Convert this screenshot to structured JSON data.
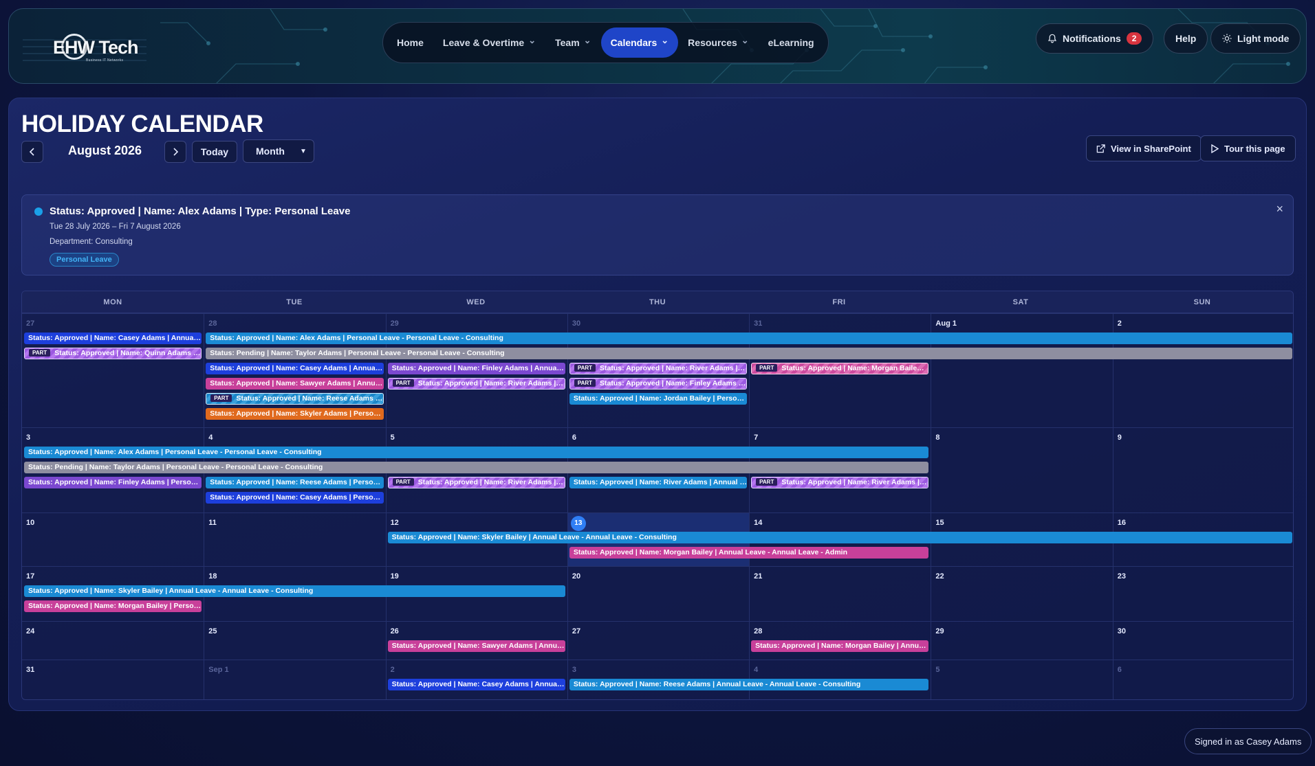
{
  "header": {
    "logo_text": "EHW Tech",
    "logo_sub": "Business IT Networks",
    "nav": [
      {
        "label": "Home",
        "dropdown": false,
        "active": false
      },
      {
        "label": "Leave & Overtime",
        "dropdown": true,
        "active": false
      },
      {
        "label": "Team",
        "dropdown": true,
        "active": false
      },
      {
        "label": "Calendars",
        "dropdown": true,
        "active": true
      },
      {
        "label": "Resources",
        "dropdown": true,
        "active": false
      },
      {
        "label": "eLearning",
        "dropdown": false,
        "active": false
      }
    ],
    "notifications_label": "Notifications",
    "notifications_count": "2",
    "help_label": "Help",
    "theme_label": "Light mode"
  },
  "page": {
    "title": "HOLIDAY CALENDAR",
    "month_label": "August 2026",
    "today_label": "Today",
    "view_select": "Month",
    "sharepoint_label": "View in SharePoint",
    "tour_label": "Tour this page"
  },
  "detail": {
    "title": "Status: Approved | Name: Alex Adams | Type: Personal Leave",
    "dates": "Tue 28 July 2026 – Fri 7 August 2026",
    "department": "Department: Consulting",
    "tag": "Personal Leave",
    "close": "×"
  },
  "calendar": {
    "weekdays": [
      "MON",
      "TUE",
      "WED",
      "THU",
      "FRI",
      "SAT",
      "SUN"
    ],
    "weeks": [
      {
        "days": [
          "27",
          "28",
          "29",
          "30",
          "31",
          "Aug 1",
          "2"
        ],
        "other": [
          true,
          true,
          true,
          true,
          true,
          false,
          false
        ]
      },
      {
        "days": [
          "3",
          "4",
          "5",
          "6",
          "7",
          "8",
          "9"
        ],
        "other": [
          false,
          false,
          false,
          false,
          false,
          false,
          false
        ]
      },
      {
        "days": [
          "10",
          "11",
          "12",
          "13",
          "14",
          "15",
          "16"
        ],
        "other": [
          false,
          false,
          false,
          false,
          false,
          false,
          false
        ]
      },
      {
        "days": [
          "17",
          "18",
          "19",
          "20",
          "21",
          "22",
          "23"
        ],
        "other": [
          false,
          false,
          false,
          false,
          false,
          false,
          false
        ]
      },
      {
        "days": [
          "24",
          "25",
          "26",
          "27",
          "28",
          "29",
          "30"
        ],
        "other": [
          false,
          false,
          false,
          false,
          false,
          false,
          false
        ]
      },
      {
        "days": [
          "31",
          "Sep 1",
          "2",
          "3",
          "4",
          "5",
          "6"
        ],
        "other": [
          false,
          true,
          true,
          true,
          true,
          true,
          true
        ]
      }
    ],
    "today": {
      "week": 2,
      "day": 3
    },
    "part_label": "PART",
    "events": [
      {
        "week": 0,
        "row": 0,
        "start": 0,
        "span": 1,
        "color": "royal",
        "part": false,
        "text": "Status: Approved | Name: Casey Adams | Annual Leave - Annual Leave - Consulting"
      },
      {
        "week": 0,
        "row": 0,
        "start": 1,
        "span": 6,
        "color": "blue",
        "part": false,
        "text": "Status: Approved | Name: Alex Adams | Personal Leave - Personal Leave - Consulting"
      },
      {
        "week": 0,
        "row": 1,
        "start": 0,
        "span": 1,
        "color": "purple",
        "part": true,
        "text": "Status: Approved | Name: Quinn Adams | Personal Leave"
      },
      {
        "week": 0,
        "row": 1,
        "start": 1,
        "span": 6,
        "color": "gray",
        "part": false,
        "text": "Status: Pending | Name: Taylor Adams | Personal Leave - Personal Leave - Consulting"
      },
      {
        "week": 0,
        "row": 2,
        "start": 1,
        "span": 1,
        "color": "royal",
        "part": false,
        "text": "Status: Approved | Name: Casey Adams | Annual Leave - Annual Leave - Consulting"
      },
      {
        "week": 0,
        "row": 2,
        "start": 2,
        "span": 1,
        "color": "purple",
        "part": false,
        "text": "Status: Approved | Name: Finley Adams | Annual Leave - Annual Leave - Consulting"
      },
      {
        "week": 0,
        "row": 2,
        "start": 3,
        "span": 1,
        "color": "purple",
        "part": true,
        "text": "Status: Approved | Name: River Adams | Personal Leave"
      },
      {
        "week": 0,
        "row": 2,
        "start": 4,
        "span": 1,
        "color": "pinkstripe",
        "part": true,
        "text": "Status: Approved | Name: Morgan Bailey | Annual Leave"
      },
      {
        "week": 0,
        "row": 3,
        "start": 1,
        "span": 1,
        "color": "pink",
        "part": false,
        "text": "Status: Approved | Name: Sawyer Adams | Annual Leave - Annual Leave - Consulting"
      },
      {
        "week": 0,
        "row": 3,
        "start": 2,
        "span": 1,
        "color": "purple",
        "part": true,
        "text": "Status: Approved | Name: River Adams | Annual Leave"
      },
      {
        "week": 0,
        "row": 3,
        "start": 3,
        "span": 1,
        "color": "purple",
        "part": true,
        "text": "Status: Approved | Name: Finley Adams | Personal Leave"
      },
      {
        "week": 0,
        "row": 4,
        "start": 1,
        "span": 1,
        "color": "bluestripe",
        "part": true,
        "text": "Status: Approved | Name: Reese Adams | Personal Leave"
      },
      {
        "week": 0,
        "row": 4,
        "start": 3,
        "span": 1,
        "color": "blue",
        "part": false,
        "text": "Status: Approved | Name: Jordan Bailey | Personal Leave - Personal Leave - Consulting"
      },
      {
        "week": 0,
        "row": 5,
        "start": 1,
        "span": 1,
        "color": "orange",
        "part": false,
        "text": "Status: Approved | Name: Skyler Adams | Personal Leave - Personal Leave - Consulting"
      },
      {
        "week": 1,
        "row": 0,
        "start": 0,
        "span": 5,
        "color": "blue",
        "part": false,
        "text": "Status: Approved | Name: Alex Adams | Personal Leave - Personal Leave - Consulting"
      },
      {
        "week": 1,
        "row": 1,
        "start": 0,
        "span": 5,
        "color": "gray",
        "part": false,
        "text": "Status: Pending | Name: Taylor Adams | Personal Leave - Personal Leave - Consulting"
      },
      {
        "week": 1,
        "row": 2,
        "start": 0,
        "span": 1,
        "color": "purple",
        "part": false,
        "text": "Status: Approved | Name: Finley Adams | Personal Leave - Personal Leave - Consulting"
      },
      {
        "week": 1,
        "row": 2,
        "start": 1,
        "span": 1,
        "color": "blue",
        "part": false,
        "text": "Status: Approved | Name: Reese Adams | Personal Leave - Personal Leave - Consulting"
      },
      {
        "week": 1,
        "row": 2,
        "start": 2,
        "span": 1,
        "color": "purple",
        "part": true,
        "text": "Status: Approved | Name: River Adams | Personal Leave"
      },
      {
        "week": 1,
        "row": 2,
        "start": 3,
        "span": 1,
        "color": "blue",
        "part": false,
        "text": "Status: Approved | Name: River Adams | Annual Leave - Annual Leave - Consulting"
      },
      {
        "week": 1,
        "row": 2,
        "start": 4,
        "span": 1,
        "color": "purple",
        "part": true,
        "text": "Status: Approved | Name: River Adams | Annual Leave"
      },
      {
        "week": 1,
        "row": 3,
        "start": 1,
        "span": 1,
        "color": "royal",
        "part": false,
        "text": "Status: Approved | Name: Casey Adams | Personal Leave - Personal Leave - Consulting"
      },
      {
        "week": 2,
        "row": 0,
        "start": 2,
        "span": 5,
        "color": "blue",
        "part": false,
        "text": "Status: Approved | Name: Skyler Bailey | Annual Leave - Annual Leave - Consulting"
      },
      {
        "week": 2,
        "row": 1,
        "start": 3,
        "span": 2,
        "color": "pink",
        "part": false,
        "text": "Status: Approved | Name: Morgan Bailey | Annual Leave - Annual Leave - Admin"
      },
      {
        "week": 3,
        "row": 0,
        "start": 0,
        "span": 3,
        "color": "blue",
        "part": false,
        "text": "Status: Approved | Name: Skyler Bailey | Annual Leave - Annual Leave - Consulting"
      },
      {
        "week": 3,
        "row": 1,
        "start": 0,
        "span": 1,
        "color": "pink",
        "part": false,
        "text": "Status: Approved | Name: Morgan Bailey | Personal Leave - Personal Leave - Admin"
      },
      {
        "week": 4,
        "row": 0,
        "start": 2,
        "span": 1,
        "color": "pink",
        "part": false,
        "text": "Status: Approved | Name: Sawyer Adams | Annual Leave - Annual Leave - Consulting"
      },
      {
        "week": 4,
        "row": 0,
        "start": 4,
        "span": 1,
        "color": "pink",
        "part": false,
        "text": "Status: Approved | Name: Morgan Bailey | Annual Leave - Annual Leave - Admin"
      },
      {
        "week": 5,
        "row": 0,
        "start": 2,
        "span": 1,
        "color": "royal",
        "part": false,
        "text": "Status: Approved | Name: Casey Adams | Annual Leave - Annual Leave - Consulting"
      },
      {
        "week": 5,
        "row": 0,
        "start": 3,
        "span": 2,
        "color": "blue",
        "part": false,
        "text": "Status: Approved | Name: Reese Adams | Annual Leave - Annual Leave - Consulting"
      }
    ]
  },
  "footer": {
    "signed_in": "Signed in as Casey Adams"
  }
}
